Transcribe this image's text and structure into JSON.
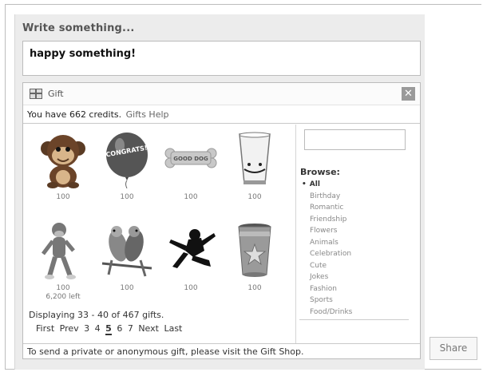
{
  "composer": {
    "label": "Write something...",
    "message": "happy something!"
  },
  "gift": {
    "title": "Gift",
    "close_icon": "close-icon",
    "credits_text": "You have 662 credits.",
    "help_link": "Gifts Help",
    "items": [
      {
        "name": "monkey",
        "price": "100",
        "left": ""
      },
      {
        "name": "congrats balloon",
        "price": "100",
        "left": ""
      },
      {
        "name": "good dog bone",
        "price": "100",
        "left": ""
      },
      {
        "name": "shot glass",
        "price": "100",
        "left": ""
      },
      {
        "name": "sock monkey",
        "price": "100",
        "left": "6,200 left"
      },
      {
        "name": "lovebirds",
        "price": "100",
        "left": ""
      },
      {
        "name": "ninja",
        "price": "100",
        "left": ""
      },
      {
        "name": "cup",
        "price": "100",
        "left": ""
      }
    ],
    "display_text": "Displaying 33 - 40 of 467 gifts.",
    "pager": {
      "first": "First",
      "prev": "Prev",
      "pages": [
        "3",
        "4",
        "5",
        "6",
        "7"
      ],
      "current": "5",
      "next": "Next",
      "last": "Last"
    },
    "search": {
      "value": "",
      "placeholder": ""
    },
    "browse_label": "Browse:",
    "categories": [
      "All",
      "Birthday",
      "Romantic",
      "Friendship",
      "Flowers",
      "Animals",
      "Celebration",
      "Cute",
      "Jokes",
      "Fashion",
      "Sports",
      "Food/Drinks"
    ],
    "active_category": "All",
    "footer_note": "To send a private or anonymous gift, please visit the Gift Shop."
  },
  "actions": {
    "share_label": "Share"
  }
}
